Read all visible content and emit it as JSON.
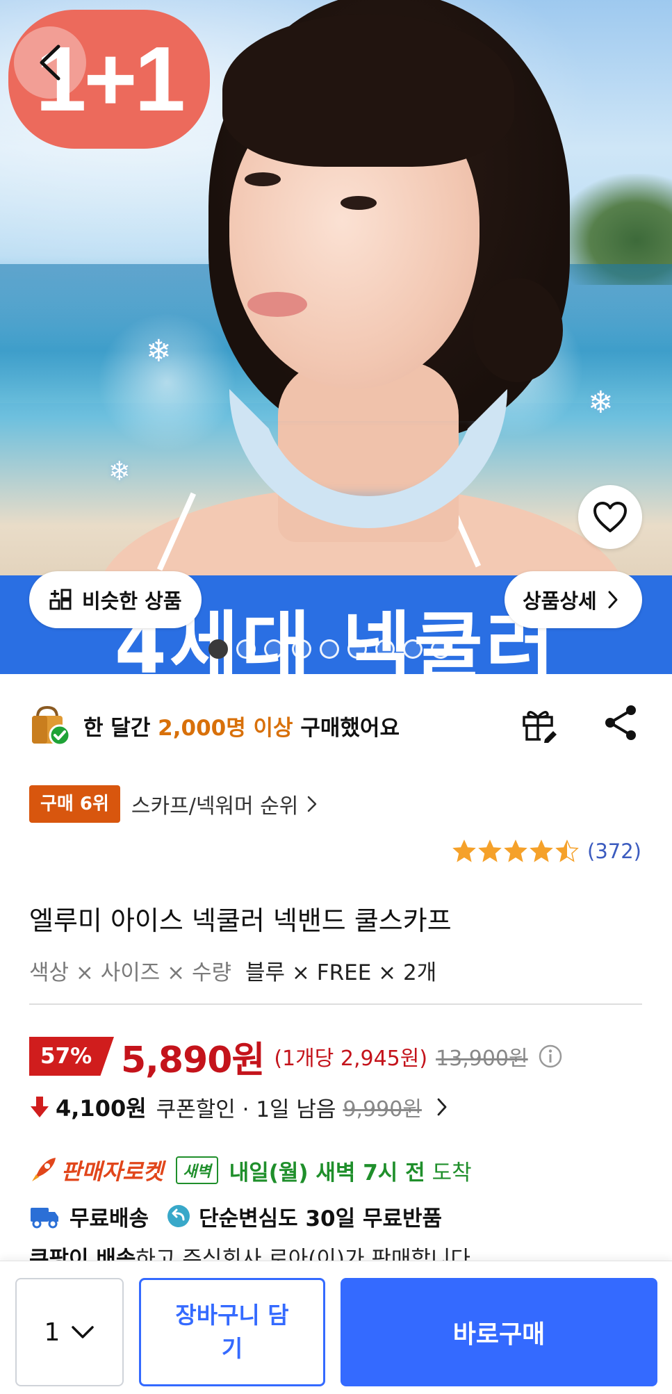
{
  "hero": {
    "promo_badge": "1+1",
    "banner_text": "4세대 넥쿨러",
    "similar_button": "비슷한 상품",
    "detail_button": "상품상세",
    "image_count": 9,
    "active_index": 0
  },
  "purchase": {
    "prefix": "한 달간 ",
    "highlight": "2,000명 이상",
    "suffix": " 구매했어요"
  },
  "rank": {
    "badge": "구매 6위",
    "category": "스카프/넥워머 순위"
  },
  "rating": {
    "stars": 4.5,
    "count": "(372)"
  },
  "product": {
    "title": "엘루미 아이스 넥쿨러 넥밴드 쿨스카프",
    "option_labels": "색상 × 사이즈 × 수량",
    "option_values": "블루 × FREE × 2개"
  },
  "price": {
    "discount": "57%",
    "sale": "5,890원",
    "unit": "(1개당 2,945원)",
    "original": "13,900원"
  },
  "coupon": {
    "amount": "4,100원",
    "label": "쿠폰할인 · 1일 남음",
    "original": "9,990원"
  },
  "delivery": {
    "rocket_label": "판매자로켓",
    "dawn_badge": "새벽",
    "time": "내일(월) 새벽 7시 전",
    "arrive": "도착"
  },
  "shipping": {
    "free_shipping": "무료배송",
    "free_return": "단순변심도 30일 무료반품"
  },
  "seller": {
    "prefix": "쿠팡이 배송",
    "suffix": "하고 주식회사 로아(이)가 판매합니다"
  },
  "bottom_bar": {
    "quantity": "1",
    "cart_button": "장바구니 담기",
    "buy_button": "바로구매"
  },
  "colors": {
    "accent_blue": "#346aff",
    "sale_red": "#c4131b",
    "rank_orange": "#d8560e",
    "delivery_green": "#1f8f2b"
  }
}
